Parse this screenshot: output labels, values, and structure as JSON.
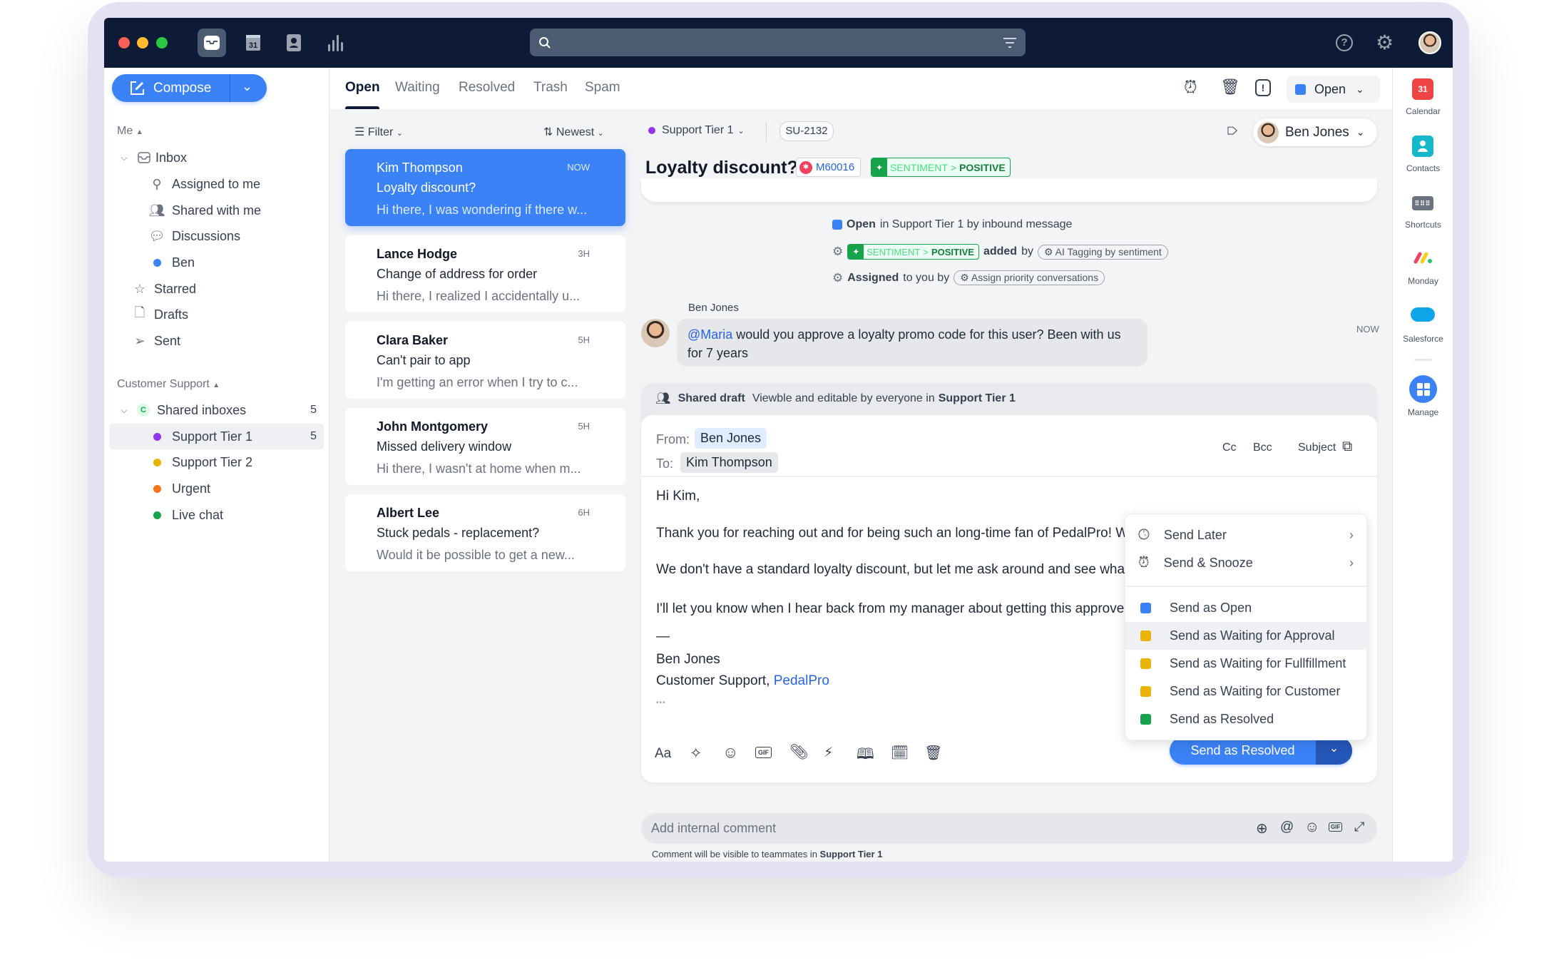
{
  "topbar": {
    "apps": [
      {
        "name": "inbox",
        "icon": "inbox-icon",
        "selected": true
      },
      {
        "name": "calendar",
        "icon": "calendar-icon",
        "day": "31"
      },
      {
        "name": "contacts",
        "icon": "contact-icon"
      },
      {
        "name": "analytics",
        "icon": "bar-chart-icon"
      }
    ],
    "search_placeholder": "",
    "colors": {
      "bar": "#0d1b36",
      "search": "#4b5b71"
    }
  },
  "compose": {
    "label": "Compose"
  },
  "sidebar": {
    "me_header": "Me",
    "inbox": "Inbox",
    "items": [
      {
        "label": "Assigned to me",
        "icon": "assigned-icon"
      },
      {
        "label": "Shared with me",
        "icon": "shared-icon"
      },
      {
        "label": "Discussions",
        "icon": "discussion-icon"
      },
      {
        "label": "Ben",
        "icon": "dot",
        "color": "#3b82f6"
      }
    ],
    "folders": [
      {
        "label": "Starred",
        "icon": "star-icon"
      },
      {
        "label": "Drafts",
        "icon": "draft-icon"
      },
      {
        "label": "Sent",
        "icon": "send-icon"
      }
    ],
    "cs_header": "Customer Support",
    "shared_inboxes": {
      "label": "Shared inboxes",
      "badge": "C",
      "count": "5"
    },
    "inboxes": [
      {
        "label": "Support Tier 1",
        "count": "5",
        "color": "#9333ea",
        "selected": true
      },
      {
        "label": "Support Tier 2",
        "color": "#eab308"
      },
      {
        "label": "Urgent",
        "color": "#f97316"
      },
      {
        "label": "Live chat",
        "color": "#16a34a"
      }
    ]
  },
  "tabs": [
    "Open",
    "Waiting",
    "Resolved",
    "Trash",
    "Spam"
  ],
  "active_tab": "Open",
  "status_dropdown": {
    "label": "Open",
    "color": "#3b82f6"
  },
  "list": {
    "filter": "Filter",
    "sort": "Newest",
    "items": [
      {
        "name": "Kim Thompson",
        "time": "NOW",
        "subject": "Loyalty discount?",
        "preview": "Hi there, I was wondering if there w..."
      },
      {
        "name": "Lance Hodge",
        "time": "3H",
        "subject": "Change of address for order",
        "preview": "Hi there, I realized I accidentally u..."
      },
      {
        "name": "Clara Baker",
        "time": "5H",
        "subject": "Can't pair to app",
        "preview": "I'm getting an error when I try to c..."
      },
      {
        "name": "John Montgomery",
        "time": "5H",
        "subject": "Missed delivery window",
        "preview": "Hi there, I wasn't at home when m..."
      },
      {
        "name": "Albert Lee",
        "time": "6H",
        "subject": "Stuck pedals - replacement?",
        "preview": "Would it be possible to get a new..."
      }
    ]
  },
  "conversation": {
    "inbox": "Support Tier 1",
    "id": "SU-2132",
    "assignee": "Ben Jones",
    "title": "Loyalty discount?",
    "linked_id": "M60016",
    "tag": {
      "category": "SENTIMENT",
      "sep": ">",
      "value": "POSITIVE"
    },
    "events": {
      "open": {
        "bold": "Open",
        "text": "in Support Tier 1 by inbound message"
      },
      "tag": {
        "bold": "added",
        "text": "by",
        "rule": "AI Tagging by sentiment"
      },
      "assign": {
        "bold": "Assigned",
        "text": "to you by",
        "rule": "Assign priority conversations"
      }
    },
    "comment": {
      "author": "Ben Jones",
      "mention": "@Maria",
      "text": " would you approve a loyalty promo code for this user? Been with us for 7 years",
      "time": "NOW"
    }
  },
  "draft": {
    "header_title": "Shared draft",
    "header_desc": "Viewble and editable by everyone in",
    "header_inbox": "Support Tier 1",
    "from_label": "From:",
    "from": "Ben Jones",
    "to_label": "To:",
    "to": "Kim Thompson",
    "cc": "Cc",
    "bcc": "Bcc",
    "subject": "Subject",
    "body": [
      "Hi Kim,",
      "Thank you for reaching out and for being such an long-time fan of PedalPro! W",
      "We don't have a standard loyalty discount, but let me ask around and see wha",
      "I'll let you know when I hear back from my manager about getting this approve",
      "—",
      "Ben Jones"
    ],
    "signature_prefix": "Customer Support, ",
    "signature_link": "PedalPro",
    "ellipsis": "•••",
    "format_label": "Aa",
    "send_label": "Send as Resolved"
  },
  "send_menu": {
    "schedule": [
      {
        "label": "Send Later",
        "icon": "clock-icon"
      },
      {
        "label": "Send & Snooze",
        "icon": "alarm-icon"
      }
    ],
    "statuses": [
      {
        "label": "Send as Open",
        "color": "#3b82f6"
      },
      {
        "label": "Send as Waiting for Approval",
        "color": "#eab308",
        "hovered": true
      },
      {
        "label": "Send as Waiting for Fullfillment",
        "color": "#eab308"
      },
      {
        "label": "Send as Waiting for Customer",
        "color": "#eab308"
      },
      {
        "label": "Send as Resolved",
        "color": "#16a34a"
      }
    ]
  },
  "internal_comment": {
    "placeholder": "Add internal comment",
    "caption_prefix": "Comment will be visible to teammates in",
    "caption_inbox": "Support Tier 1"
  },
  "right_rail": [
    {
      "label": "Calendar",
      "color": "#ef4444",
      "glyph": "31"
    },
    {
      "label": "Contacts",
      "color": "#14b8c8"
    },
    {
      "label": "Shortcuts",
      "color": "#6b7280"
    },
    {
      "label": "Monday"
    },
    {
      "label": "Salesforce",
      "color": "#0ea5e9"
    },
    {
      "label": "Manage",
      "color": "#3b82f6"
    }
  ]
}
